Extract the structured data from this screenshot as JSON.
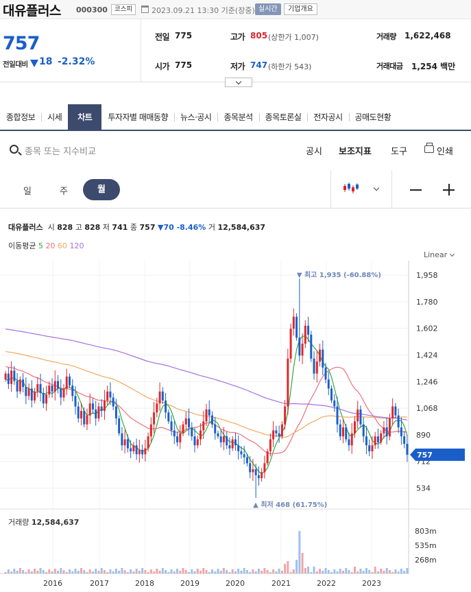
{
  "header": {
    "stock_name": "대유플러스",
    "stock_code": "000300",
    "market": "코스피",
    "datetime": "2023.09.21 13:30 기준(장중)",
    "realtime": "실시간",
    "company_btn": "기업개요"
  },
  "price": {
    "current": "757",
    "vs_label": "전일대비",
    "change": "18",
    "rate": "-2.32%",
    "prev_label": "전일",
    "prev": "775",
    "open_label": "시가",
    "open": "775",
    "high_label": "고가",
    "high": "805",
    "upper_limit": "(상한가 1,007)",
    "low_label": "저가",
    "low": "747",
    "lower_limit": "(하한가 543)",
    "volume_label": "거래량",
    "volume": "1,622,468",
    "amount_label": "거래대금",
    "amount": "1,254 백만"
  },
  "tabs": [
    "종합정보",
    "시세",
    "차트",
    "투자자별 매매동향",
    "뉴스·공시",
    "종목분석",
    "종목토론실",
    "전자공시",
    "공매도현황"
  ],
  "active_tab": "차트",
  "toolbar": {
    "search_placeholder": "종목 또는 지수비교",
    "disclosure": "공시",
    "indicator": "보조지표",
    "tools": "도구",
    "print": "인쇄"
  },
  "periods": {
    "day": "일",
    "week": "주",
    "month": "월"
  },
  "chart_header": {
    "name": "대유플러스",
    "open_label": "시",
    "open": "828",
    "high_label": "고",
    "high": "828",
    "low_label": "저",
    "low": "741",
    "close_label": "종",
    "close": "757",
    "change": "▼70 -8.46%",
    "vol_label": "거",
    "vol": "12,584,637",
    "ma_label": "이동평균",
    "ma5": "5",
    "ma20": "20",
    "ma60": "60",
    "ma120": "120"
  },
  "scale_mode": "Linear",
  "volume_label": "거래량",
  "volume_value": "12,584,637",
  "colors": {
    "up": "#e0262c",
    "down": "#1a5fc9",
    "ma5": "#2eaa3c",
    "ma20": "#ee6e7a",
    "ma60": "#f4a860",
    "ma120": "#a86ee0",
    "nav": "#3c4a6e"
  },
  "chart_data": {
    "type": "candlestick",
    "x_labels": [
      "2016",
      "2017",
      "2018",
      "2019",
      "2020",
      "2021",
      "2022",
      "2023"
    ],
    "y_ticks": [
      534,
      712,
      890,
      1068,
      1246,
      1424,
      1602,
      1780,
      1958
    ],
    "ylim": [
      440,
      2000
    ],
    "volume_ticks": [
      "268m",
      "535m",
      "803m"
    ],
    "max_annotation": "최고 1,935 (-60.88%)",
    "min_annotation": "최저 468 (61.75%)",
    "current_label": "757",
    "current_value": 757,
    "max_value": 1935,
    "min_value": 468
  }
}
